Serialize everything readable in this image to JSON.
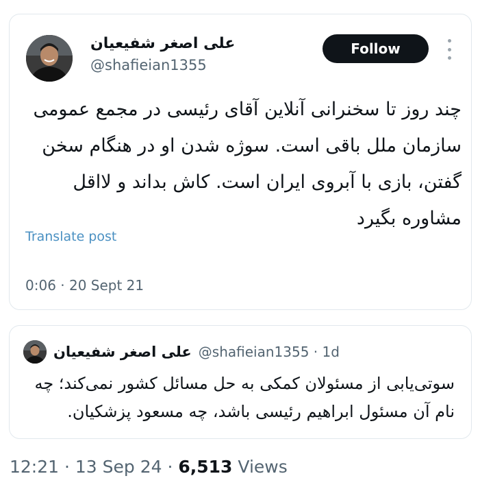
{
  "tweet": {
    "author_name": "علی اصغر شفیعیان",
    "handle": "@shafieian1355",
    "follow_label": "Follow",
    "text": "چند روز تا سخنرانی آنلاین آقای رئیسی در مجمع عمومی سازمان ملل باقی است. سوژه شدن او در هنگام سخن گفتن، بازی با آبروی ایران است. کاش بداند و لااقل مشاوره بگیرد",
    "translate_label": "Translate post",
    "timestamp": "0:06 · 20 Sept 21"
  },
  "quote": {
    "author_name": "علی اصغر شفیعیان",
    "meta": "@shafieian1355 · 1d",
    "text": "سوتی‌یابی از مسئولان کمکی به حل مسائل کشور نمی‌کند؛ چه نام آن مسئول ابراهیم رئیسی باشد، چه مسعود پزشکیان."
  },
  "footer": {
    "timestamp": "12:21 · 13 Sep 24 · ",
    "views_count": "6,513",
    "views_label": " Views"
  },
  "colors": {
    "follow_bg": "#0f1419",
    "link": "#4a90c2",
    "muted": "#536471"
  }
}
